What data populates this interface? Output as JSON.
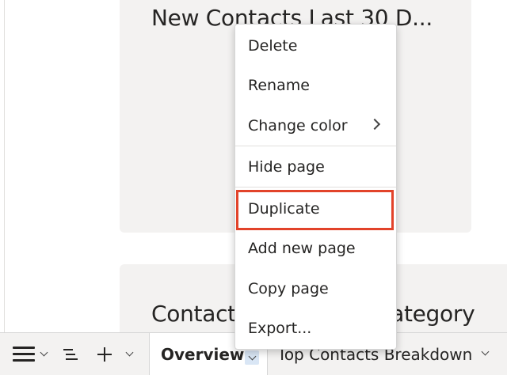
{
  "tiles": {
    "tile1_title": "New Contacts Last 30 D...",
    "tile2_title_left": "Contact",
    "tile2_title_right": "Category"
  },
  "context_menu": {
    "items": [
      {
        "label": "Delete"
      },
      {
        "label": "Rename"
      },
      {
        "label": "Change color",
        "submenu": true
      },
      {
        "label": "Hide page"
      },
      {
        "label": "Duplicate",
        "highlighted": true
      },
      {
        "label": "Add new page"
      },
      {
        "label": "Copy page"
      },
      {
        "label": "Export..."
      }
    ]
  },
  "tabbar": {
    "tabs": [
      {
        "label": "Overview",
        "active": true
      },
      {
        "label": "Top Contacts Breakdown",
        "active": false
      }
    ]
  },
  "colors": {
    "highlight_border": "#e2432a",
    "active_tab_chevron_bg": "#d9e6f5"
  }
}
